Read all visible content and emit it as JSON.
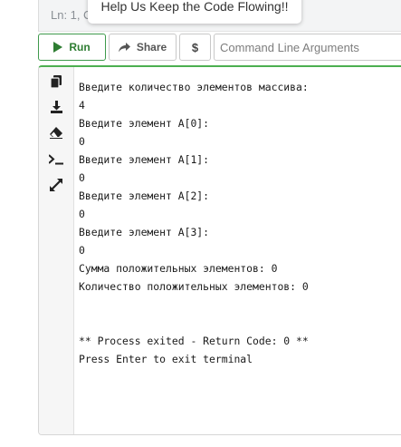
{
  "editor": {
    "position_label": "Ln: 1,",
    "position_col_fragment": "C"
  },
  "tooltip": {
    "text": "Help Us Keep the Code Flowing!!"
  },
  "toolbar": {
    "run_label": "Run",
    "share_label": "Share",
    "donate_label": "$",
    "args_placeholder": "Command Line Arguments"
  },
  "terminal": {
    "side_icons": [
      "copy-icon",
      "download-icon",
      "clear-icon",
      "terminal-prompt-icon",
      "expand-icon"
    ],
    "lines": [
      "Введите количество элементов массива:",
      "4",
      "Введите элемент A[0]:",
      "0",
      "Введите элемент A[1]:",
      "0",
      "Введите элемент A[2]:",
      "0",
      "Введите элемент A[3]:",
      "0",
      "Сумма положительных элементов: 0",
      "Количество положительных элементов: 0",
      "",
      "",
      "** Process exited - Return Code: 0 **",
      "Press Enter to exit terminal"
    ]
  },
  "colors": {
    "accent_green": "#4caf50",
    "run_text": "#2e7d32"
  }
}
